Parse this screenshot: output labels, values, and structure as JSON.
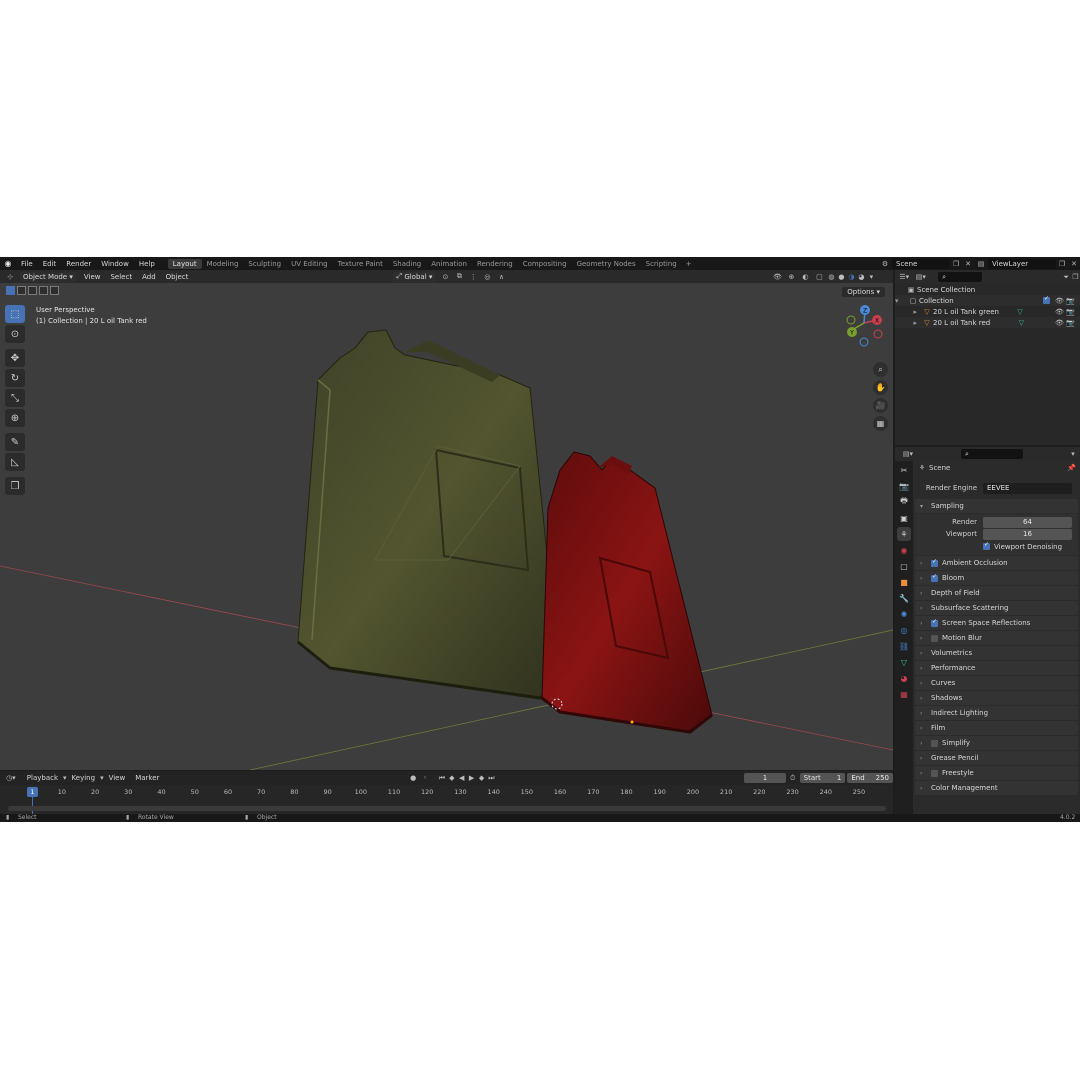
{
  "topbar": {
    "menus": [
      "File",
      "Edit",
      "Render",
      "Window",
      "Help"
    ],
    "workspaces": [
      "Layout",
      "Modeling",
      "Sculpting",
      "UV Editing",
      "Texture Paint",
      "Shading",
      "Animation",
      "Rendering",
      "Compositing",
      "Geometry Nodes",
      "Scripting"
    ],
    "active_workspace": "Layout",
    "add_label": "+",
    "scene": "Scene",
    "view_layer": "ViewLayer"
  },
  "viewport": {
    "mode": "Object Mode",
    "menus": [
      "View",
      "Select",
      "Add",
      "Object"
    ],
    "orientation": "Global",
    "options": "Options",
    "info_line1": "User Perspective",
    "info_line2": "(1) Collection | 20 L oil Tank red",
    "gizmo": {
      "x": "X",
      "y": "Y",
      "z": "Z"
    }
  },
  "timeline": {
    "menus": [
      "Playback",
      "Keying",
      "View",
      "Marker"
    ],
    "current_frame": "1",
    "start_label": "Start",
    "start": "1",
    "end_label": "End",
    "end": "250",
    "ticks": [
      "10",
      "20",
      "30",
      "40",
      "50",
      "60",
      "70",
      "80",
      "90",
      "100",
      "110",
      "120",
      "130",
      "140",
      "150",
      "160",
      "170",
      "180",
      "190",
      "200",
      "210",
      "220",
      "230",
      "240",
      "250"
    ]
  },
  "statusbar": {
    "select": "Select",
    "rotate": "Rotate View",
    "object": "Object",
    "version": "4.0.2"
  },
  "outliner": {
    "scene_collection": "Scene Collection",
    "collection": "Collection",
    "items": [
      "20 L oil Tank green",
      "20 L oil Tank red"
    ]
  },
  "properties": {
    "scene_label": "Scene",
    "render_engine_label": "Render Engine",
    "render_engine": "EEVEE",
    "sampling": "Sampling",
    "render_label": "Render",
    "render_value": "64",
    "viewport_label": "Viewport",
    "viewport_value": "16",
    "viewport_denoising": "Viewport Denoising",
    "panels": [
      {
        "label": "Ambient Occlusion",
        "check": "on"
      },
      {
        "label": "Bloom",
        "check": "on"
      },
      {
        "label": "Depth of Field",
        "check": "none"
      },
      {
        "label": "Subsurface Scattering",
        "check": "none"
      },
      {
        "label": "Screen Space Reflections",
        "check": "on"
      },
      {
        "label": "Motion Blur",
        "check": "off"
      },
      {
        "label": "Volumetrics",
        "check": "none"
      },
      {
        "label": "Performance",
        "check": "none"
      },
      {
        "label": "Curves",
        "check": "none"
      },
      {
        "label": "Shadows",
        "check": "none"
      },
      {
        "label": "Indirect Lighting",
        "check": "none"
      },
      {
        "label": "Film",
        "check": "none"
      },
      {
        "label": "Simplify",
        "check": "off"
      },
      {
        "label": "Grease Pencil",
        "check": "none"
      },
      {
        "label": "Freestyle",
        "check": "off"
      },
      {
        "label": "Color Management",
        "check": "none"
      }
    ]
  },
  "colors": {
    "accent": "#4772b3",
    "tank_green": "#4a4d2e",
    "tank_red": "#7a1212",
    "viewport_bg": "#3d3d3d"
  }
}
